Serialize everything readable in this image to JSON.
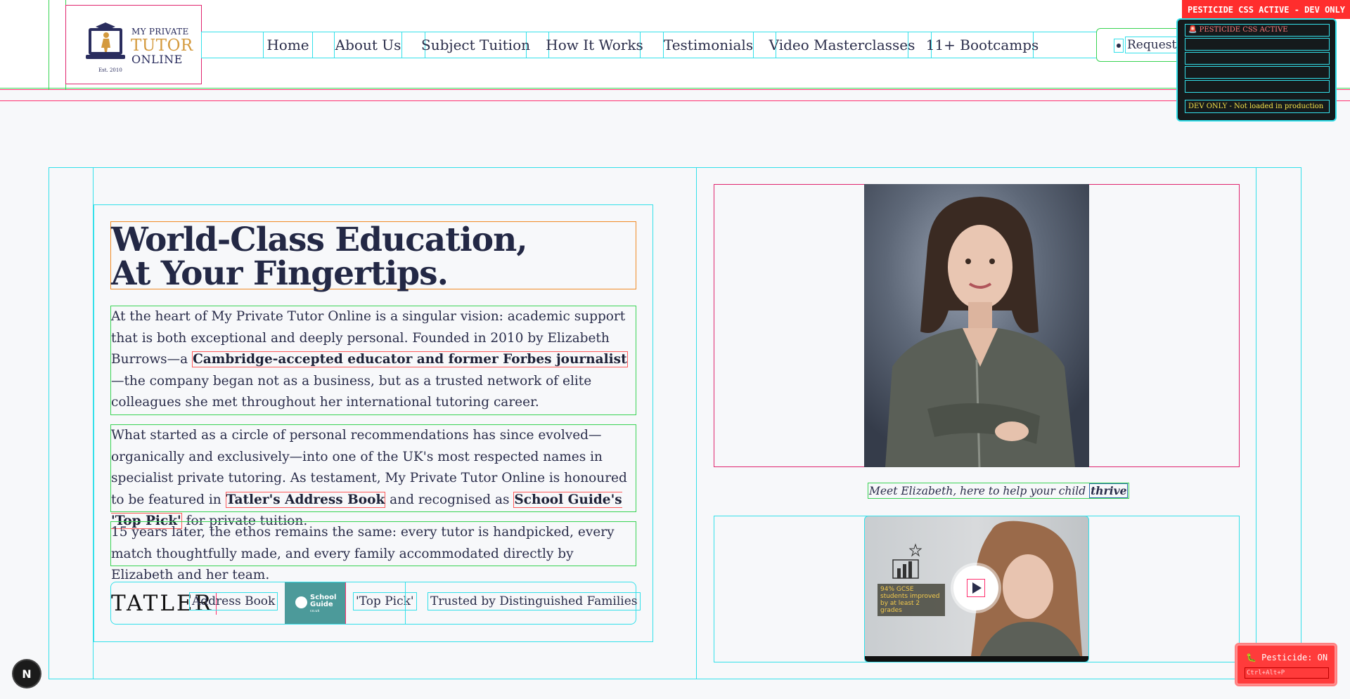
{
  "header": {
    "logo": {
      "line1": "MY PRIVATE",
      "line2": "TUTOR",
      "line3": "ONLINE",
      "est": "Est. 2010"
    },
    "nav": [
      {
        "label": "Home"
      },
      {
        "label": "About Us"
      },
      {
        "label": "Subject Tuition"
      },
      {
        "label": "How It Works"
      },
      {
        "label": "Testimonials"
      },
      {
        "label": "Video Masterclasses"
      },
      {
        "label": "11+ Bootcamps"
      }
    ],
    "request_label": "Request F"
  },
  "pesticide": {
    "tag": "PESTICIDE CSS ACTIVE - DEV ONLY",
    "panel_title": "🚨 PESTICIDE CSS ACTIVE",
    "panel_footer": "DEV ONLY - Not loaded in production",
    "toggle_label": "🐛 Pesticide: ON",
    "toggle_shortcut": "Ctrl+Alt+P"
  },
  "hero": {
    "headline_line1": "World-Class Education,",
    "headline_line2": "At Your Fingertips.",
    "p1_a": "At the heart of My Private Tutor Online is a singular vision: academic support that is both exceptional and deeply personal. Founded in 2010 by Elizabeth Burrows—a ",
    "p1_bold": "Cambridge-accepted educator and former Forbes journalist",
    "p1_b": "—the company began not as a business, but as a trusted network of elite colleagues she met throughout her international tutoring career.",
    "p2_a": "What started as a circle of personal recommendations has since evolved—organically and exclusively—into one of the UK's most respected names in specialist private tutoring. As testament, My Private Tutor Online is honoured to be featured in ",
    "p2_bold1": "Tatler's Address Book",
    "p2_b": " and recognised as ",
    "p2_bold2": "School Guide's 'Top Pick'",
    "p2_c": " for private tuition.",
    "p3": "15 years later, the ethos remains the same: every tutor is handpicked, every match thoughtfully made, and every family accommodated directly by Elizabeth and her team."
  },
  "trust": {
    "tatler": "TATLER",
    "address_book": "Address Book",
    "school_guide_line1": "School",
    "school_guide_line2": "Guide",
    "school_guide_sub": "co.uk",
    "top_pick": "'Top Pick'",
    "trusted": "Trusted by Distinguished Families"
  },
  "right": {
    "caption_a": "Meet Elizabeth, here to help your child ",
    "caption_em": "thrive",
    "video_stat": "94% GCSE students improved by at least 2 grades"
  },
  "dev": {
    "next_badge": "N"
  }
}
